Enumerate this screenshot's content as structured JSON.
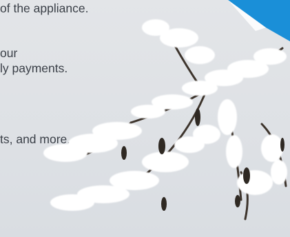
{
  "banner": {
    "lines": [
      "of the appliance.",
      "our",
      "ly payments.",
      "ts, and more."
    ]
  },
  "colors": {
    "background": "#dfe2e6",
    "text": "#3a3f47",
    "accent_corner": "#1a8fd8",
    "branch": "#3d342c",
    "snow": "#ffffff"
  },
  "decor": {
    "corner_icon": "blue-corner-ribbon",
    "image": "snow-covered-branch"
  }
}
